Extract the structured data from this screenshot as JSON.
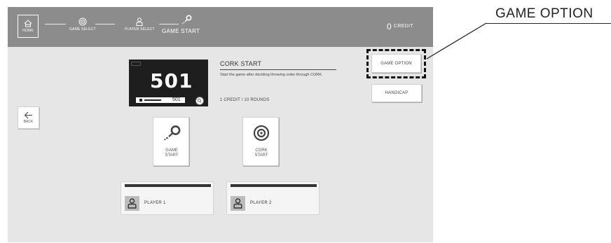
{
  "header": {
    "home_label": "HOME",
    "steps": [
      {
        "label": "GAME SELECT",
        "icon": "dartboard-icon"
      },
      {
        "label": "PLAYER SELECT",
        "icon": "person-icon"
      },
      {
        "label": "GAME START",
        "icon": "dart-icon"
      }
    ],
    "credit_count": "0",
    "credit_label": "CREDIT"
  },
  "back_label": "BACK",
  "game_preview": {
    "score": "501",
    "bar_score": "501"
  },
  "mode": {
    "title": "CORK START",
    "description": "Start the game after deciding throwing order through CORK.",
    "cost": "1 CREDIT / 10 ROUNDS"
  },
  "buttons": {
    "game_option": "GAME OPTION",
    "handicap": "HANDICAP",
    "game_start": [
      "GAME",
      "START"
    ],
    "cork_start": [
      "CORK",
      "START"
    ]
  },
  "players": [
    {
      "label": "PLAYER 1"
    },
    {
      "label": "PLAYER 2"
    }
  ],
  "callout": {
    "label": "GAME OPTION"
  }
}
